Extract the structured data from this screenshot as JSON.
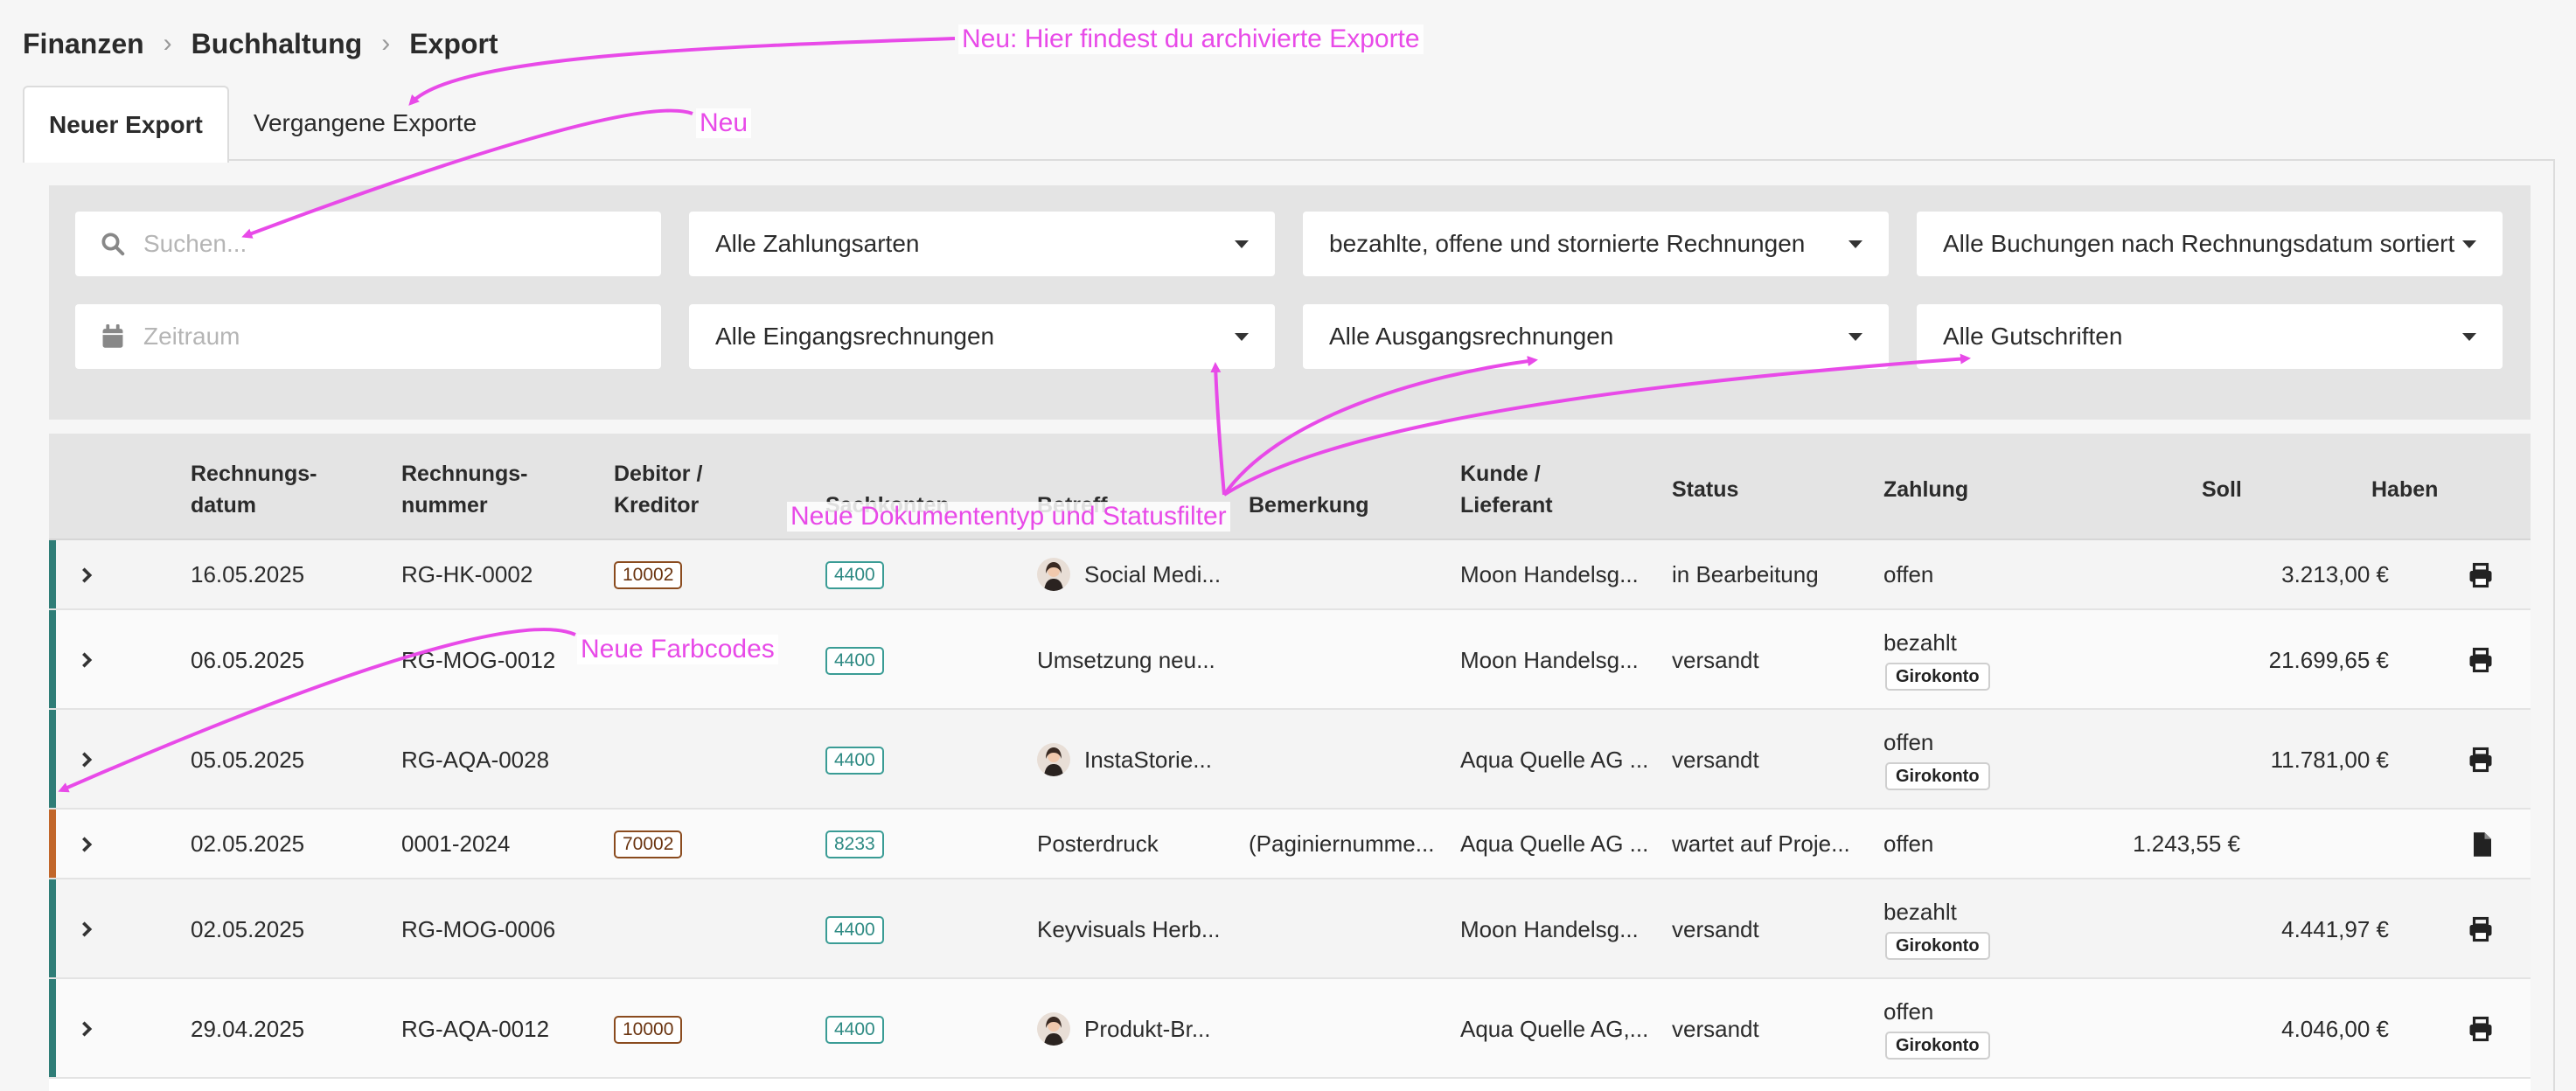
{
  "breadcrumb": [
    "Finanzen",
    "Buchhaltung",
    "Export"
  ],
  "tabs": [
    {
      "label": "Neuer Export",
      "active": true
    },
    {
      "label": "Vergangene Exporte",
      "active": false
    }
  ],
  "filters": {
    "search_placeholder": "Suchen...",
    "period_placeholder": "Zeitraum",
    "payment_types": "Alle Zahlungsarten",
    "invoice_states": "bezahlte, offene und stornierte Rechnungen",
    "sorting": "Alle Buchungen nach Rechnungsdatum sortiert",
    "incoming": "Alle Eingangsrechnungen",
    "outgoing": "Alle Ausgangsrechnungen",
    "credits": "Alle Gutschriften"
  },
  "columns": {
    "date": [
      "Rechnungs-",
      "datum"
    ],
    "number": [
      "Rechnungs-",
      "nummer"
    ],
    "party": [
      "Debitor /",
      "Kreditor"
    ],
    "accounts": "Sachkonten",
    "subject": "Betreff",
    "remark": "Bemerkung",
    "customer": [
      "Kunde /",
      "Lieferant"
    ],
    "status": "Status",
    "payment": "Zahlung",
    "debit": "Soll",
    "credit": "Haben"
  },
  "rows": [
    {
      "date": "16.05.2025",
      "number": "RG-HK-0002",
      "party": "10002",
      "account": "4400",
      "subject": "Social Medi...",
      "remark": "",
      "customer": "Moon Handelsg...",
      "status": "in Bearbeitung",
      "payment": "offen",
      "payment_badge": "",
      "debit": "",
      "credit": "3.213,00 €"
    },
    {
      "date": "06.05.2025",
      "number": "RG-MOG-0012",
      "party": "",
      "account": "4400",
      "subject": "Umsetzung neu...",
      "remark": "",
      "customer": "Moon Handelsg...",
      "status": "versandt",
      "payment": "bezahlt",
      "payment_badge": "Girokonto",
      "debit": "",
      "credit": "21.699,65 €"
    },
    {
      "date": "05.05.2025",
      "number": "RG-AQA-0028",
      "party": "",
      "account": "4400",
      "subject": "InstaStorie...",
      "remark": "",
      "customer": "Aqua Quelle AG ...",
      "status": "versandt",
      "payment": "offen",
      "payment_badge": "Girokonto",
      "debit": "",
      "credit": "11.781,00 €"
    },
    {
      "date": "02.05.2025",
      "number": "0001-2024",
      "party": "70002",
      "account": "8233",
      "subject": "Posterdruck",
      "remark": "(Paginiernumme...",
      "customer": "Aqua Quelle AG ...",
      "status": "wartet auf Proje...",
      "payment": "offen",
      "payment_badge": "",
      "debit": "1.243,55 €",
      "credit": ""
    },
    {
      "date": "02.05.2025",
      "number": "RG-MOG-0006",
      "party": "",
      "account": "4400",
      "subject": "Keyvisuals Herb...",
      "remark": "",
      "customer": "Moon Handelsg...",
      "status": "versandt",
      "payment": "bezahlt",
      "payment_badge": "Girokonto",
      "debit": "",
      "credit": "4.441,97 €"
    },
    {
      "date": "29.04.2025",
      "number": "RG-AQA-0012",
      "party": "10000",
      "account": "4400",
      "subject": "Produkt-Br...",
      "remark": "",
      "customer": "Aqua Quelle AG,...",
      "status": "versandt",
      "payment": "offen",
      "payment_badge": "Girokonto",
      "debit": "",
      "credit": "4.046,00 €"
    }
  ],
  "annotations": {
    "archived": "Neu: Hier findest du archivierte Exporte",
    "search": "Neu",
    "doc_type": "Neue Dokumententyp und Statusfilter",
    "colors": "Neue  Farbcodes"
  },
  "colors": {
    "teal_stripe": "#2f7d77",
    "orange_stripe": "#c1662a",
    "annotation": "#e84ae8"
  }
}
